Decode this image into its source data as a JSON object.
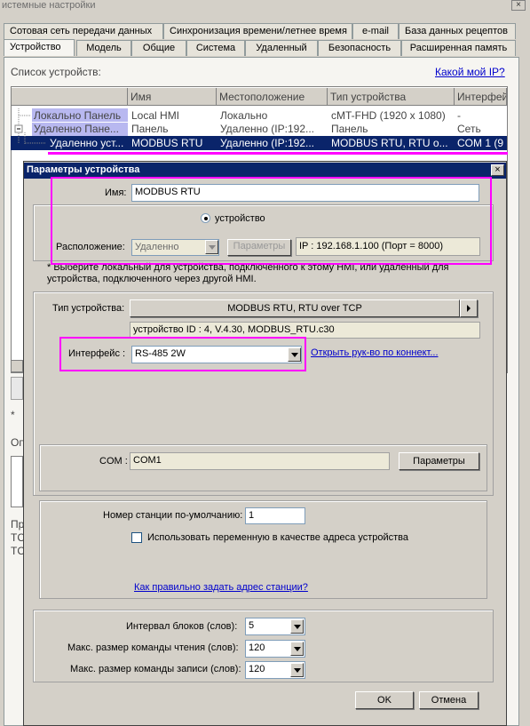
{
  "window": {
    "title": "истемные настройки",
    "close": "×"
  },
  "tabs_row1": [
    "Сотовая сеть передачи данных",
    "Синхронизация времени/летнее время",
    "e-mail",
    "База данных рецептов"
  ],
  "tabs_row2": [
    "Устройство",
    "Модель",
    "Общие",
    "Система",
    "Удаленный",
    "Безопасность",
    "Расширенная память"
  ],
  "device_list": {
    "label": "Список устройств:",
    "ip_link": "Какой мой IP?",
    "columns": [
      "",
      "Имя",
      "Местоположение",
      "Тип устройства",
      "Интерфейс"
    ],
    "rows": [
      {
        "tree": "Локально Панель",
        "name": "Local HMI",
        "location": "Локально",
        "type": "cMT-FHD (1920 x 1080)",
        "iface": "-"
      },
      {
        "tree": "Удаленно Пане...",
        "name": "Панель",
        "location": "Удаленно (IP:192...",
        "type": "Панель",
        "iface": "Сеть"
      },
      {
        "tree": "Удаленно уст...",
        "name": "MODBUS RTU",
        "location": "Удаленно (IP:192...",
        "type": "MODBUS RTU, RTU о...",
        "iface": "COM 1 (9"
      }
    ]
  },
  "bg_side": {
    "star": "* ",
    "op": "Оп",
    "pr": "Пр",
    "tc1": "TC",
    "tc2": "TC"
  },
  "dialog": {
    "title": "Параметры устройства",
    "close": "×",
    "name_label": "Имя:",
    "name_value": "MODBUS RTU",
    "radio_device": "устройство",
    "location_label": "Расположение:",
    "location_value": "Удаленно",
    "location_params_btn": "Параметры",
    "ip_info": "IP : 192.168.1.100 (Порт = 8000)",
    "note": "* Выберите локальный для устройства, подключенного к этому HMI, или удаленный для устройства, подключенного через другой HMI.",
    "device_type_label": "Тип устройства:",
    "device_type_value": "MODBUS RTU, RTU over TCP",
    "device_id_info": "устройство ID : 4, V.4.30, MODBUS_RTU.c30",
    "interface_label": "Интерфейс :",
    "interface_value": "RS-485 2W",
    "manual_link": "Открыть рук-во по коннект...",
    "com_label": "COM :",
    "com_value": "COM1",
    "com_params_btn": "Параметры",
    "station_label": "Номер станции по-умолчанию:",
    "station_value": "1",
    "use_var_label": "Использовать переменную в качестве адреса устройства",
    "station_link": "Как правильно задать адрес станции?",
    "block_interval_label": "Интервал блоков (слов):",
    "block_interval_value": "5",
    "max_read_label": "Макс. размер команды чтения (слов):",
    "max_read_value": "120",
    "max_write_label": "Макс. размер команды записи (слов):",
    "max_write_value": "120",
    "ok_btn": "OK",
    "cancel_btn": "Отмена"
  },
  "colors": {
    "selection": "#0a246a",
    "highlight_box": "#ff00ff",
    "link": "#0000cc"
  }
}
